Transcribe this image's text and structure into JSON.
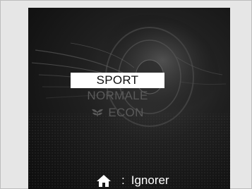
{
  "drive_mode_menu": {
    "items": [
      {
        "label": "SPORT",
        "selected": true
      },
      {
        "label": "NORMALE",
        "selected": false
      },
      {
        "label": "ECON",
        "selected": false,
        "icon": "eco-leaf-icon"
      }
    ]
  },
  "footer": {
    "icon": "home-icon",
    "separator": ":",
    "label": "Ignorer"
  },
  "colors": {
    "selected_bg": "#ffffff",
    "selected_text": "#111111",
    "unselected_text": "#5a5a5a",
    "screen_bg": "#141414"
  }
}
